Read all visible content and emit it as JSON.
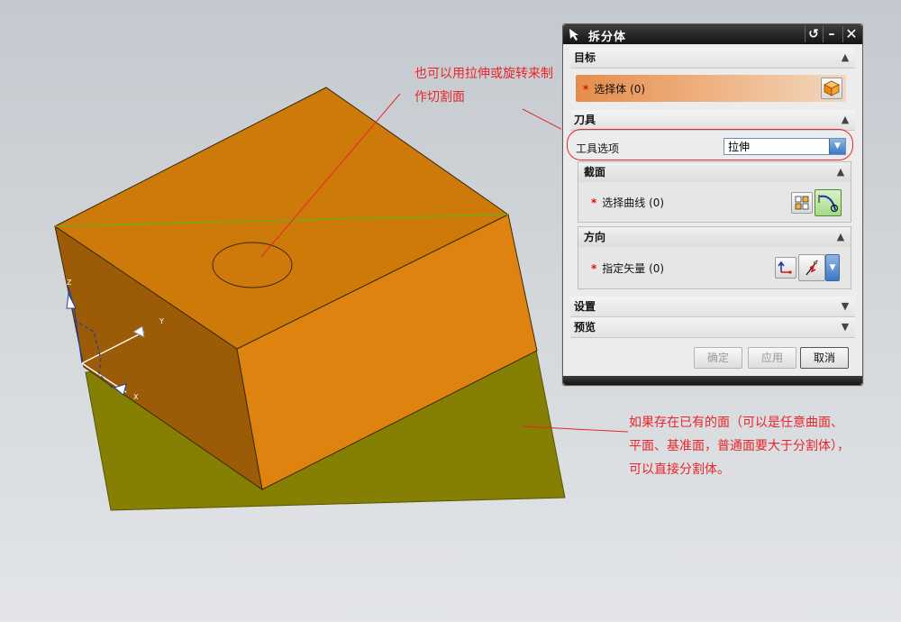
{
  "dialog": {
    "title": "拆分体",
    "sections": {
      "target": {
        "header": "目标",
        "select_body_label": "选择体 (0)"
      },
      "tool": {
        "header": "刀具",
        "tool_option_label": "工具选项",
        "tool_option_value": "拉伸",
        "section_panel": {
          "header": "截面",
          "select_curve_label": "选择曲线 (0)"
        },
        "direction_panel": {
          "header": "方向",
          "specify_vector_label": "指定矢量 (0)"
        }
      },
      "settings": {
        "header": "设置"
      },
      "preview": {
        "header": "预览"
      }
    },
    "buttons": {
      "ok": "确定",
      "apply": "应用",
      "cancel": "取消"
    }
  },
  "annotations": {
    "top": "也可以用拉伸或旋转来制作切割面",
    "bottom": "如果存在已有的面（可以是任意曲面、平面、基准面，普通面要大于分割体），可以直接分割体。"
  },
  "axis_labels": {
    "z": "Z",
    "y": "Y",
    "x": "X"
  },
  "colors": {
    "box_top": "#cd7a0b",
    "box_right": "#df8310",
    "box_left": "#9c5b06",
    "plane": "#857f03",
    "annotation": "#e8262a",
    "highlight": "#f0b688"
  },
  "icons": {
    "title": "arrow-cursor-icon",
    "reset": "reset-icon",
    "minimize": "minimize-icon",
    "close": "close-icon",
    "body": "orange-cube-icon",
    "curve": "curve-select-icon",
    "vector": "vector-icon"
  }
}
